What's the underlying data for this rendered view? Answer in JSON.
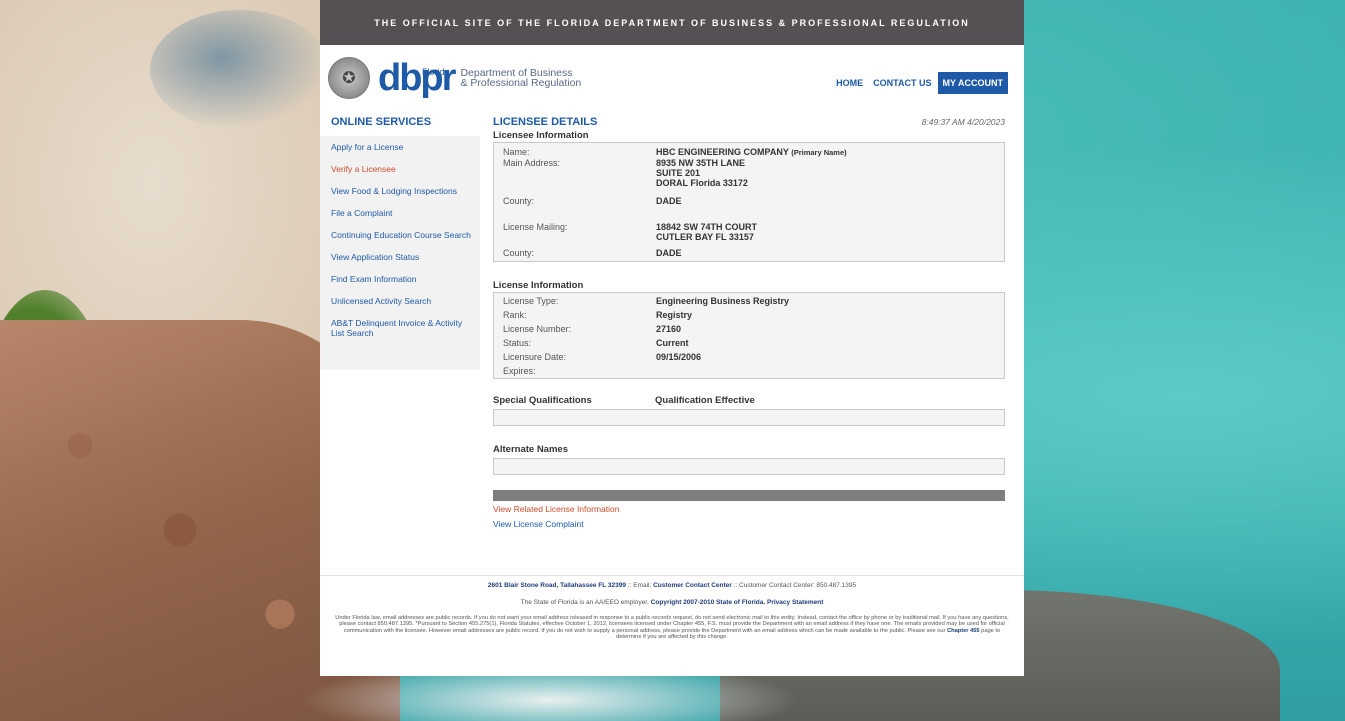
{
  "banner": {
    "text": "THE OFFICIAL SITE OF THE FLORIDA DEPARTMENT OF BUSINESS & PROFESSIONAL REGULATION"
  },
  "logo": {
    "florida": "Florida",
    "wordmark": "dbpr",
    "dept_line1": "Department of Business",
    "dept_line2": "& Professional Regulation",
    "seal_icon": "state-seal-icon"
  },
  "topnav": {
    "home": "HOME",
    "contact": "CONTACT US",
    "account": "MY ACCOUNT"
  },
  "sidebar": {
    "title": "ONLINE SERVICES",
    "items": [
      {
        "label": "Apply for a License"
      },
      {
        "label": "Verify a Licensee"
      },
      {
        "label": "View Food & Lodging Inspections"
      },
      {
        "label": "File a Complaint"
      },
      {
        "label": "Continuing Education Course Search"
      },
      {
        "label": "View Application Status"
      },
      {
        "label": "Find Exam Information"
      },
      {
        "label": "Unlicensed Activity Search"
      },
      {
        "label": "AB&T Delinquent Invoice & Activity List Search"
      }
    ]
  },
  "main": {
    "title": "LICENSEE DETAILS",
    "timestamp": "8:49:37 AM 4/20/2023",
    "licensee_info": {
      "heading": "Licensee Information",
      "name_label": "Name:",
      "name_value": "HBC ENGINEERING COMPANY",
      "name_suffix": "(Primary Name)",
      "main_address_label": "Main Address:",
      "main_address_line1": "8935 NW 35TH LANE",
      "main_address_line2": "SUITE 201",
      "main_address_line3": "DORAL  Florida  33172",
      "county_label": "County:",
      "county_value": "DADE",
      "mailing_label": "License Mailing:",
      "mailing_line1": "18842 SW 74TH COURT",
      "mailing_line2": "CUTLER BAY  FL  33157",
      "county2_label": "County:",
      "county2_value": "DADE"
    },
    "license_info": {
      "heading": "License Information",
      "type_label": "License Type:",
      "type_value": "Engineering Business Registry",
      "rank_label": "Rank:",
      "rank_value": "Registry",
      "number_label": "License Number:",
      "number_value": "27160",
      "status_label": "Status:",
      "status_value": "Current",
      "date_label": "Licensure Date:",
      "date_value": "09/15/2006",
      "expires_label": "Expires:"
    },
    "special_qualifications": "Special Qualifications",
    "qualification_effective": "Qualification Effective",
    "alternate_names": "Alternate Names",
    "link_related": "View Related License Information",
    "link_complaint": "View License Complaint"
  },
  "footer": {
    "address": "2601 Blair Stone Road, Tallahassee FL 32399",
    "email_label": " :: Email: ",
    "email_link": "Customer Contact Center",
    "contact_center": " :: Customer Contact Center: 850.487.1395",
    "eeo": "The State of Florida is an AA/EEO employer. ",
    "copyright": "Copyright 2007-2010 State of Florida.",
    "privacy": "Privacy Statement",
    "para_part1": "Under Florida law, email addresses are public records. If you do not want your email address released in response to a public-records request, do not send electronic mail to this entity. Instead, contact the office by phone or by traditional mail. If you have any questions, please contact 850.487.1395. *Pursuant to Section 455.275(1), Florida Statutes, effective October 1, 2012, licensees licensed under Chapter 455, F.S. must provide the Department with an email address if they have one. The emails provided may be used for official communication with the licensee. However email addresses are public record. If you do not wish to supply a personal address, please provide the Department with an email address which can be made available to the public. Please see our ",
    "chapter_link": "Chapter 455",
    "para_part2": " page to determine if you are affected by this change."
  },
  "colors": {
    "brand_blue": "#1e5aa8",
    "active_link": "#d14a2b",
    "banner_bg": "#545054"
  }
}
